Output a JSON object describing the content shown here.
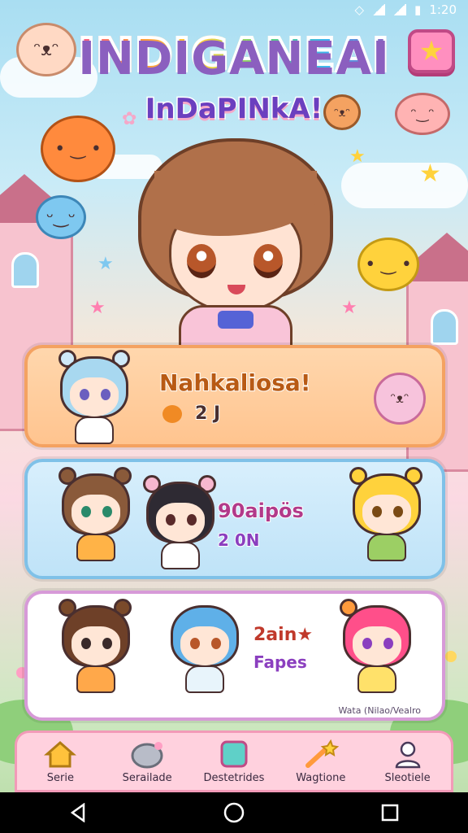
{
  "status_bar": {
    "time": "1:20"
  },
  "header": {
    "title": "INDIGANEAI",
    "subtitle": "InDaPINkA!"
  },
  "card1": {
    "name": "Nahkaliosa!",
    "stat": "2 J"
  },
  "card2": {
    "label": "90aipös",
    "sub": "2 0N"
  },
  "card3": {
    "label": "2ain★",
    "sub": "Fapes",
    "footer": "Wata (Nilao/Vealro"
  },
  "nav": {
    "items": [
      {
        "label": "Serie",
        "icon": "home-icon"
      },
      {
        "label": "Serailade",
        "icon": "pet-icon"
      },
      {
        "label": "Destetrides",
        "icon": "square-icon"
      },
      {
        "label": "Wagtione",
        "icon": "wand-icon"
      },
      {
        "label": "Sleotiele",
        "icon": "profile-icon"
      }
    ]
  },
  "colors": {
    "accent_pink": "#ff8fbf",
    "card_orange": "#ffc48f",
    "card_blue": "#bfe3f8",
    "nav_bg": "#ffd1de"
  }
}
